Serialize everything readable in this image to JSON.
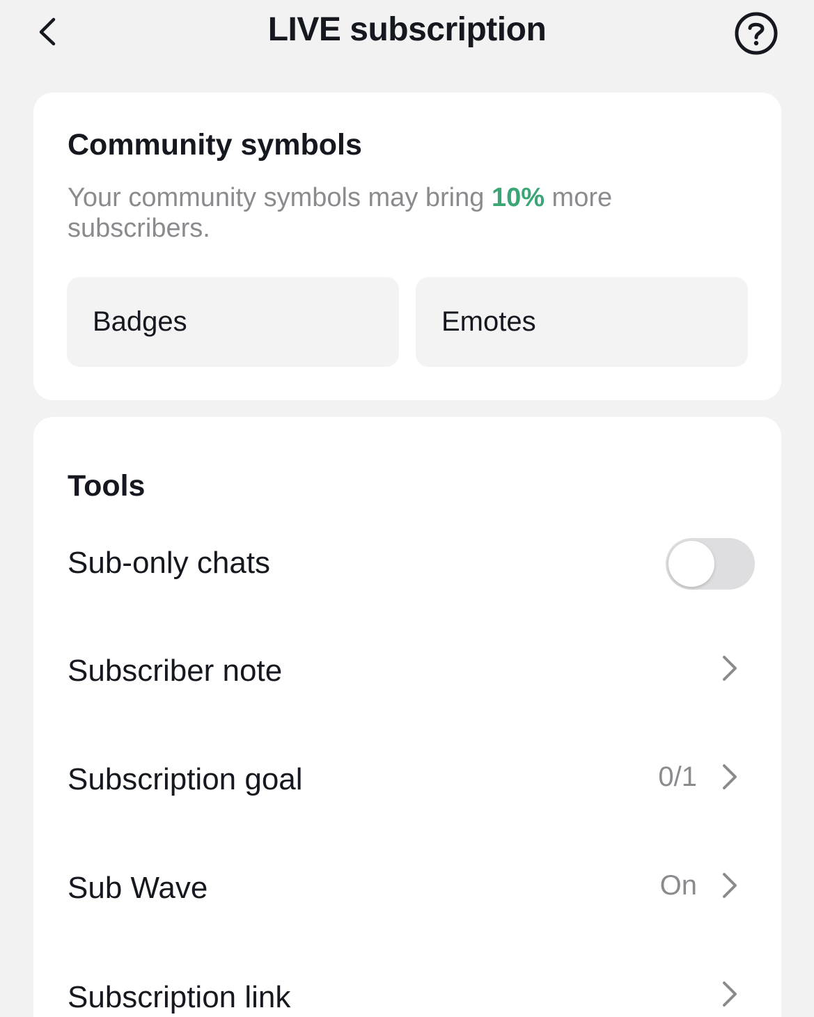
{
  "header": {
    "title": "LIVE subscription",
    "back_icon": "chevron-left-icon",
    "help_icon": "question-circle-icon"
  },
  "community_symbols": {
    "heading": "Community symbols",
    "desc_before": "Your community symbols may bring ",
    "desc_highlight": "10%",
    "desc_after": " more subscribers.",
    "highlight_color": "#3ba675",
    "tiles": [
      {
        "label": "Badges"
      },
      {
        "label": "Emotes"
      }
    ]
  },
  "tools": {
    "heading": "Tools",
    "sub_only_chats": {
      "label": "Sub-only chats",
      "enabled": false
    },
    "subscriber_note": {
      "label": "Subscriber note"
    },
    "subscription_goal": {
      "label": "Subscription goal",
      "value": "0/1"
    },
    "sub_wave": {
      "label": "Sub Wave",
      "value": "On"
    },
    "subscription_link": {
      "label": "Subscription link"
    }
  }
}
